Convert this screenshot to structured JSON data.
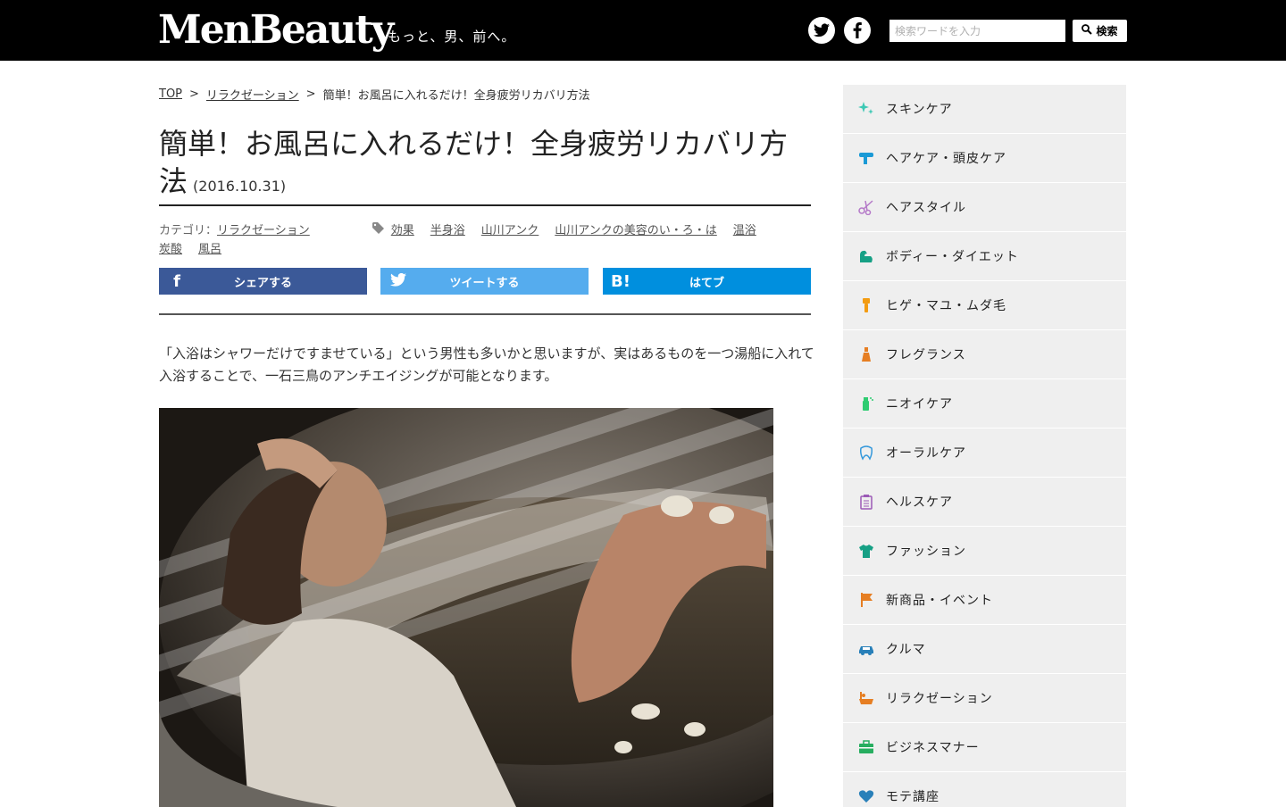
{
  "header": {
    "logo": "MenBeauty",
    "tagline": "もっと、男、前へ。",
    "search_placeholder": "検索ワードを入力",
    "search_button": "検索"
  },
  "breadcrumb": {
    "items": [
      "TOP",
      "リラクゼーション",
      "簡単！お風呂に入れるだけ！全身疲労リカバリ方法"
    ],
    "separator": ">"
  },
  "article": {
    "title": "簡単！お風呂に入れるだけ！全身疲労リカバリ方法",
    "date": "(2016.10.31)",
    "category_label": "カテゴリ：",
    "category": "リラクゼーション",
    "tags": [
      "効果",
      "半身浴",
      "山川アンク",
      "山川アンクの美容のい・ろ・は",
      "温浴",
      "炭酸",
      "風呂"
    ],
    "lead": "「入浴はシャワーだけですませている」という男性も多いかと思いますが、実はあるものを一つ湯船に入れて入浴することで、一石三鳥のアンチエイジングが可能となります。"
  },
  "share": {
    "facebook": "シェアする",
    "twitter": "ツイートする",
    "hatena_icon": "B!",
    "hatena": "はてブ"
  },
  "sidebar": {
    "items": [
      {
        "label": "スキンケア",
        "icon": "sparkle-icon",
        "color": "#3cc8b4"
      },
      {
        "label": "ヘアケア・頭皮ケア",
        "icon": "hairdryer-icon",
        "color": "#1a9ad6"
      },
      {
        "label": "ヘアスタイル",
        "icon": "scissors-icon",
        "color": "#b478c8"
      },
      {
        "label": "ボディー・ダイエット",
        "icon": "arm-icon",
        "color": "#16a085"
      },
      {
        "label": "ヒゲ・マユ・ムダ毛",
        "icon": "razor-icon",
        "color": "#f39c12"
      },
      {
        "label": "フレグランス",
        "icon": "perfume-icon",
        "color": "#e67e22"
      },
      {
        "label": "ニオイケア",
        "icon": "spray-icon",
        "color": "#2ecc71"
      },
      {
        "label": "オーラルケア",
        "icon": "tooth-icon",
        "color": "#3498db"
      },
      {
        "label": "ヘルスケア",
        "icon": "clipboard-icon",
        "color": "#9b59b6"
      },
      {
        "label": "ファッション",
        "icon": "tshirt-icon",
        "color": "#16a085"
      },
      {
        "label": "新商品・イベント",
        "icon": "flag-icon",
        "color": "#e67e22"
      },
      {
        "label": "クルマ",
        "icon": "car-icon",
        "color": "#2980b9"
      },
      {
        "label": "リラクゼーション",
        "icon": "bath-icon",
        "color": "#e67e22"
      },
      {
        "label": "ビジネスマナー",
        "icon": "briefcase-icon",
        "color": "#27ae60"
      },
      {
        "label": "モテ講座",
        "icon": "heart-icon",
        "color": "#2980b9"
      }
    ]
  }
}
